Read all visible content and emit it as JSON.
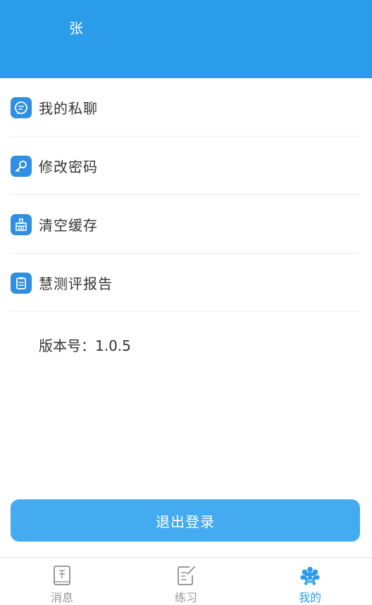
{
  "header": {
    "user_name": "张"
  },
  "menu": {
    "items": [
      {
        "label": "我的私聊",
        "icon": "chat-bubble-icon"
      },
      {
        "label": "修改密码",
        "icon": "key-icon"
      },
      {
        "label": "清空缓存",
        "icon": "broom-icon"
      },
      {
        "label": "慧测评报告",
        "icon": "clipboard-icon"
      }
    ]
  },
  "version": {
    "text": "版本号：1.0.5"
  },
  "logout": {
    "label": "退出登录"
  },
  "tabbar": {
    "tabs": [
      {
        "label": "消息",
        "icon": "message-book-icon",
        "active": false
      },
      {
        "label": "练习",
        "icon": "edit-note-icon",
        "active": false
      },
      {
        "label": "我的",
        "icon": "profile-flower-icon",
        "active": true
      }
    ]
  },
  "colors": {
    "primary": "#2b9cea",
    "button": "#45abf0",
    "tab_inactive": "#999999"
  }
}
